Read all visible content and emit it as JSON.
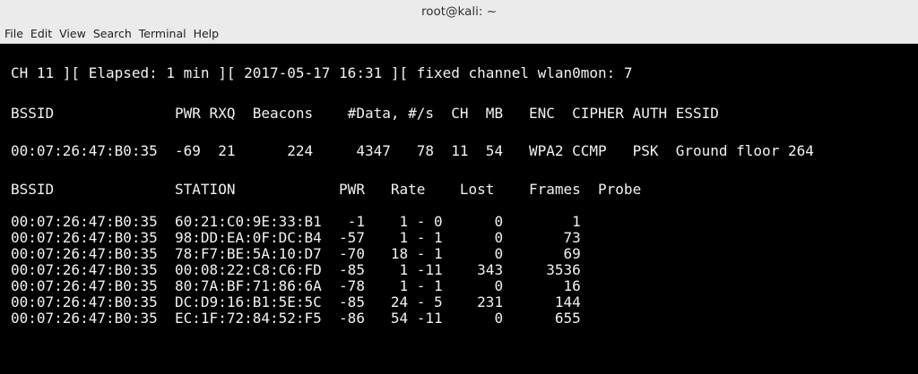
{
  "window": {
    "title": "root@kali: ~"
  },
  "menu": [
    "File",
    "Edit",
    "View",
    "Search",
    "Terminal",
    "Help"
  ],
  "terminal": {
    "status_line": "CH 11 ][ Elapsed: 1 min ][ 2017-05-17 16:31 ][ fixed channel wlan0mon: 7",
    "ap_header": "BSSID              PWR RXQ  Beacons    #Data, #/s  CH  MB   ENC  CIPHER AUTH ESSID",
    "ap_rows": [
      "00:07:26:47:B0:35  -69  21      224     4347   78  11  54   WPA2 CCMP   PSK  Ground floor 264"
    ],
    "station_header": "BSSID              STATION            PWR   Rate    Lost    Frames  Probe",
    "station_rows": [
      "00:07:26:47:B0:35  60:21:C0:9E:33:B1   -1    1 - 0      0        1",
      "00:07:26:47:B0:35  98:DD:EA:0F:DC:B4  -57    1 - 1      0       73",
      "00:07:26:47:B0:35  78:F7:BE:5A:10:D7  -70   18 - 1      0       69",
      "00:07:26:47:B0:35  00:08:22:C8:C6:FD  -85    1 -11    343     3536",
      "00:07:26:47:B0:35  80:7A:BF:71:86:6A  -78    1 - 1      0       16",
      "00:07:26:47:B0:35  DC:D9:16:B1:5E:5C  -85   24 - 5    231      144",
      "00:07:26:47:B0:35  EC:1F:72:84:52:F5  -86   54 -11      0      655"
    ]
  }
}
